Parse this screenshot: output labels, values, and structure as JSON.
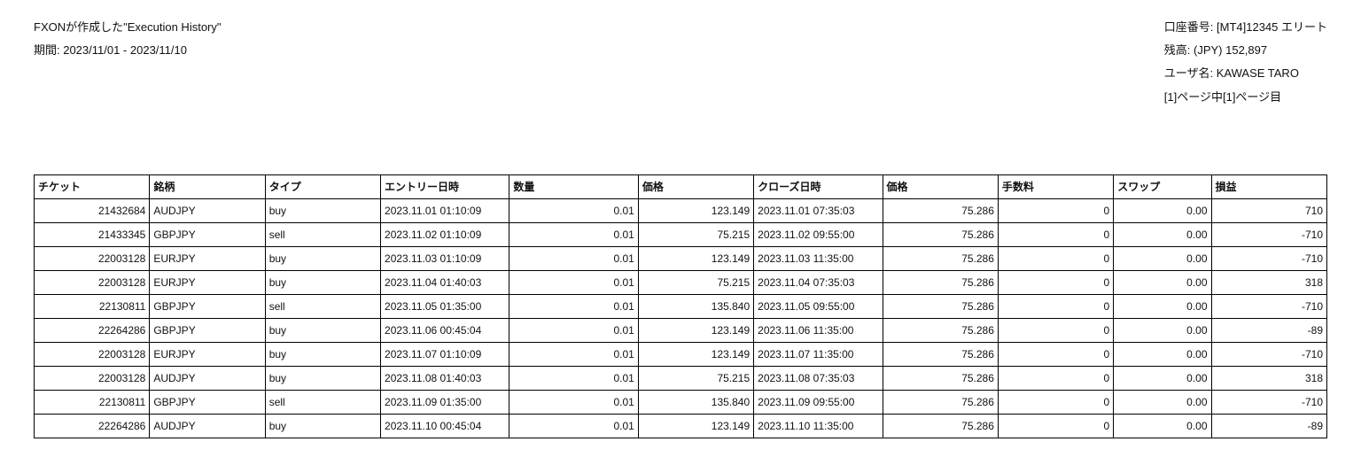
{
  "header": {
    "title_line": "FXONが作成した\"Execution History\"",
    "period_label": "期間: 2023/11/01 - 2023/11/10",
    "account_line": "口座番号: [MT4]12345 エリート",
    "balance_line": "残高: (JPY) 152,897",
    "user_line": "ユーザ名: KAWASE TARO",
    "page_line": "[1]ページ中[1]ページ目"
  },
  "columns": {
    "ticket": "チケット",
    "symbol": "銘柄",
    "type": "タイプ",
    "entry_time": "エントリー日時",
    "volume": "数量",
    "open_price": "価格",
    "close_time": "クローズ日時",
    "close_price": "価格",
    "commission": "手数料",
    "swap": "スワップ",
    "profit": "損益"
  },
  "rows": [
    {
      "ticket": "21432684",
      "symbol": "AUDJPY",
      "type": "buy",
      "entry_time": "2023.11.01 01:10:09",
      "volume": "0.01",
      "open_price": "123.149",
      "close_time": "2023.11.01 07:35:03",
      "close_price": "75.286",
      "commission": "0",
      "swap": "0.00",
      "profit": "710"
    },
    {
      "ticket": "21433345",
      "symbol": "GBPJPY",
      "type": "sell",
      "entry_time": "2023.11.02 01:10:09",
      "volume": "0.01",
      "open_price": "75.215",
      "close_time": "2023.11.02 09:55:00",
      "close_price": "75.286",
      "commission": "0",
      "swap": "0.00",
      "profit": "-710"
    },
    {
      "ticket": "22003128",
      "symbol": "EURJPY",
      "type": "buy",
      "entry_time": "2023.11.03 01:10:09",
      "volume": "0.01",
      "open_price": "123.149",
      "close_time": "2023.11.03 11:35:00",
      "close_price": "75.286",
      "commission": "0",
      "swap": "0.00",
      "profit": "-710"
    },
    {
      "ticket": "22003128",
      "symbol": "EURJPY",
      "type": "buy",
      "entry_time": "2023.11.04 01:40:03",
      "volume": "0.01",
      "open_price": "75.215",
      "close_time": "2023.11.04 07:35:03",
      "close_price": "75.286",
      "commission": "0",
      "swap": "0.00",
      "profit": "318"
    },
    {
      "ticket": "22130811",
      "symbol": "GBPJPY",
      "type": "sell",
      "entry_time": "2023.11.05 01:35:00",
      "volume": "0.01",
      "open_price": "135.840",
      "close_time": "2023.11.05 09:55:00",
      "close_price": "75.286",
      "commission": "0",
      "swap": "0.00",
      "profit": "-710"
    },
    {
      "ticket": "22264286",
      "symbol": "GBPJPY",
      "type": "buy",
      "entry_time": "2023.11.06 00:45:04",
      "volume": "0.01",
      "open_price": "123.149",
      "close_time": "2023.11.06 11:35:00",
      "close_price": "75.286",
      "commission": "0",
      "swap": "0.00",
      "profit": "-89"
    },
    {
      "ticket": "22003128",
      "symbol": "EURJPY",
      "type": "buy",
      "entry_time": "2023.11.07 01:10:09",
      "volume": "0.01",
      "open_price": "123.149",
      "close_time": "2023.11.07 11:35:00",
      "close_price": "75.286",
      "commission": "0",
      "swap": "0.00",
      "profit": "-710"
    },
    {
      "ticket": "22003128",
      "symbol": "AUDJPY",
      "type": "buy",
      "entry_time": "2023.11.08 01:40:03",
      "volume": "0.01",
      "open_price": "75.215",
      "close_time": "2023.11.08 07:35:03",
      "close_price": "75.286",
      "commission": "0",
      "swap": "0.00",
      "profit": "318"
    },
    {
      "ticket": "22130811",
      "symbol": "GBPJPY",
      "type": "sell",
      "entry_time": "2023.11.09 01:35:00",
      "volume": "0.01",
      "open_price": "135.840",
      "close_time": "2023.11.09 09:55:00",
      "close_price": "75.286",
      "commission": "0",
      "swap": "0.00",
      "profit": "-710"
    },
    {
      "ticket": "22264286",
      "symbol": "AUDJPY",
      "type": "buy",
      "entry_time": "2023.11.10 00:45:04",
      "volume": "0.01",
      "open_price": "123.149",
      "close_time": "2023.11.10 11:35:00",
      "close_price": "75.286",
      "commission": "0",
      "swap": "0.00",
      "profit": "-89"
    }
  ]
}
